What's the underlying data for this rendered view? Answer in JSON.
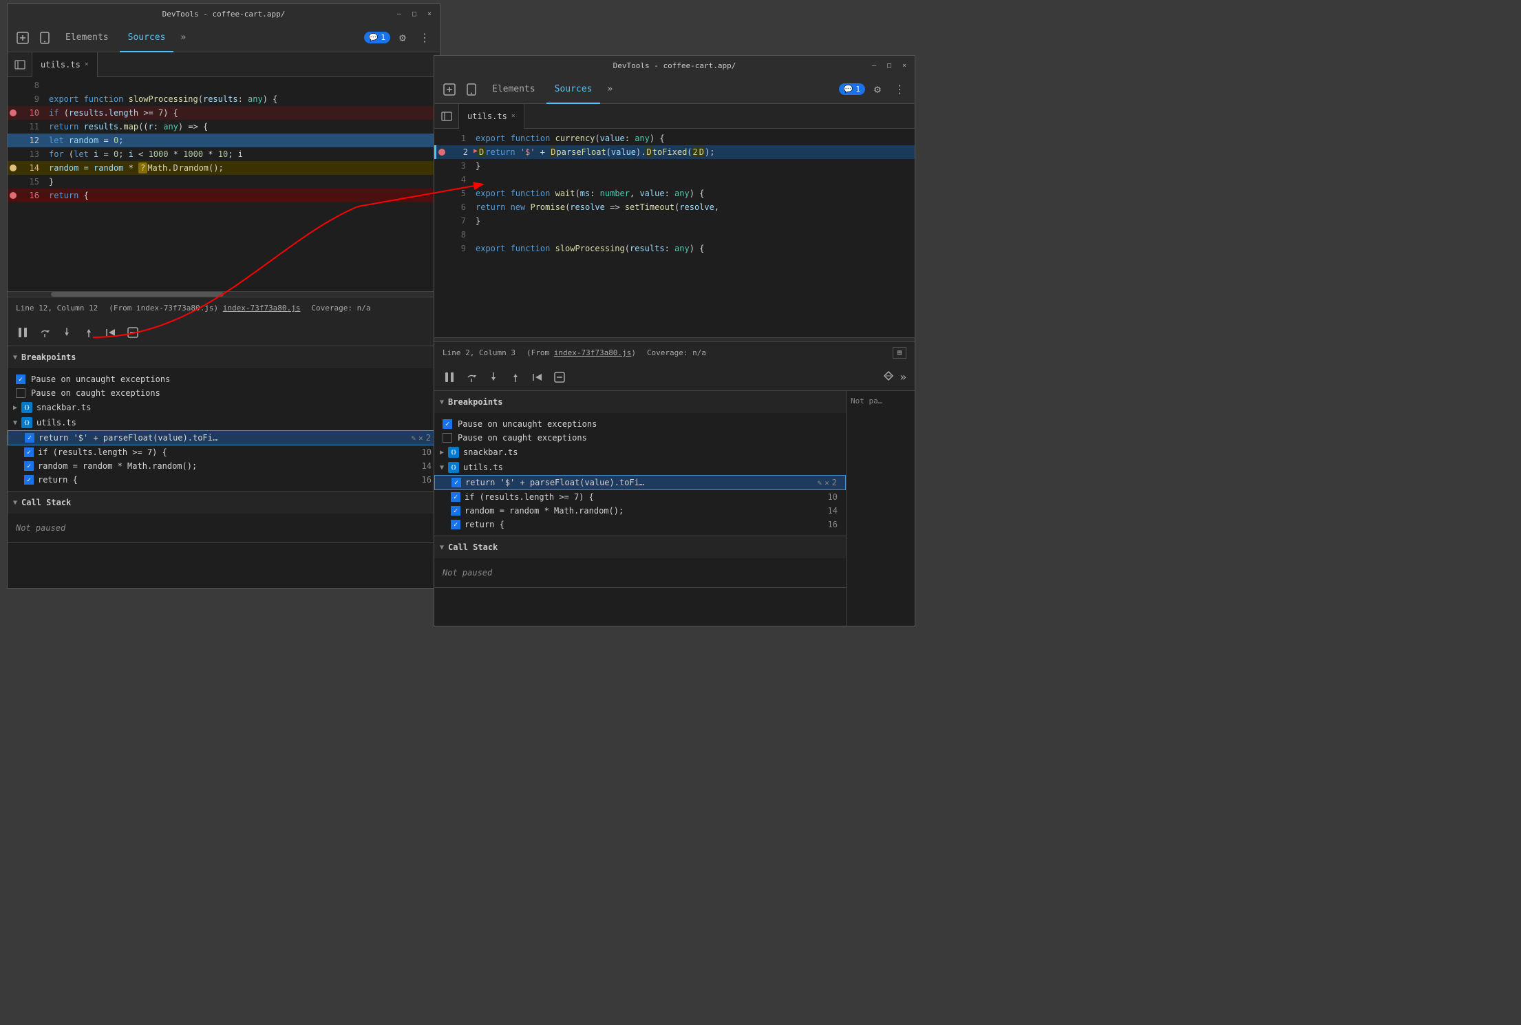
{
  "window1": {
    "title": "DevTools - coffee-cart.app/",
    "tabs": [
      "Elements",
      "Sources"
    ],
    "active_tab": "Sources",
    "file_tab": "utils.ts",
    "code_lines": [
      {
        "num": 8,
        "content": "",
        "type": "normal"
      },
      {
        "num": 9,
        "content": "export function slowProcessing(results: any) {",
        "type": "truncated"
      },
      {
        "num": 10,
        "content": "  if (results.length >= 7) {",
        "type": "breakpoint"
      },
      {
        "num": 11,
        "content": "    return results.map((r: any) => {",
        "type": "normal"
      },
      {
        "num": 12,
        "content": "      let random = 0;",
        "type": "normal"
      },
      {
        "num": 13,
        "content": "      for (let i = 0; i < 1000 * 1000 * 10; i",
        "type": "truncated"
      },
      {
        "num": 14,
        "content": "        random = random * Math.random();",
        "type": "breakpoint_question"
      },
      {
        "num": 15,
        "content": "      }",
        "type": "normal"
      },
      {
        "num": 16,
        "content": "      return {",
        "type": "breakpoint_active"
      }
    ],
    "status_line": "Line 12, Column 12",
    "status_from": "(From index-73f73a80.js)",
    "status_coverage": "Coverage: n/a",
    "debugger_sections": {
      "breakpoints_label": "Breakpoints",
      "pause_uncaught": "Pause on uncaught exceptions",
      "pause_caught": "Pause on caught exceptions",
      "files": [
        {
          "name": "snackbar.ts",
          "expanded": false
        },
        {
          "name": "utils.ts",
          "expanded": true,
          "breakpoints": [
            {
              "code": "return '$' + parseFloat(value).toFi…",
              "line": "2",
              "selected": true
            },
            {
              "code": "if (results.length >= 7) {",
              "line": "10"
            },
            {
              "code": "random = random * Math.random();",
              "line": "14"
            },
            {
              "code": "return {",
              "line": "16"
            }
          ]
        }
      ]
    },
    "call_stack_label": "Call Stack"
  },
  "window2": {
    "title": "DevTools - coffee-cart.app/",
    "tabs": [
      "Elements",
      "Sources"
    ],
    "active_tab": "Sources",
    "file_tab": "utils.ts",
    "code_lines": [
      {
        "num": 1,
        "content": "export function currency(value: any) {",
        "type": "normal"
      },
      {
        "num": 2,
        "content": "  return '$' + parseFloat(value).toFixed(2);",
        "type": "execution"
      },
      {
        "num": 3,
        "content": "}",
        "type": "normal"
      },
      {
        "num": 4,
        "content": "",
        "type": "normal"
      },
      {
        "num": 5,
        "content": "export function wait(ms: number, value: any) {",
        "type": "normal"
      },
      {
        "num": 6,
        "content": "  return new Promise(resolve => setTimeout(resolve,",
        "type": "truncated"
      },
      {
        "num": 7,
        "content": "}",
        "type": "normal"
      },
      {
        "num": 8,
        "content": "",
        "type": "normal"
      },
      {
        "num": 9,
        "content": "export function slowProcessing(results: any) {",
        "type": "normal"
      }
    ],
    "status_line": "Line 2, Column 3",
    "status_from": "(From index-73f73a80.js)",
    "status_coverage": "Coverage: n/a",
    "debugger_sections": {
      "breakpoints_label": "Breakpoints",
      "pause_uncaught": "Pause on uncaught exceptions",
      "pause_caught": "Pause on caught exceptions",
      "files": [
        {
          "name": "snackbar.ts",
          "expanded": false
        },
        {
          "name": "utils.ts",
          "expanded": true,
          "breakpoints": [
            {
              "code": "return '$' + parseFloat(value).toFi…",
              "line": "2",
              "selected": true
            },
            {
              "code": "if (results.length >= 7) {",
              "line": "10"
            },
            {
              "code": "random = random * Math.random();",
              "line": "14"
            },
            {
              "code": "return {",
              "line": "16"
            }
          ]
        }
      ]
    },
    "call_stack_label": "Call Stack",
    "not_paused": "Not pa…",
    "panel_right": "Not pa…"
  },
  "icons": {
    "close": "×",
    "minimize": "—",
    "maximize": "□",
    "chevron_right": "▶",
    "chevron_down": "▼",
    "gear": "⚙",
    "more": "⋮",
    "chat": "💬",
    "pause": "⏸",
    "step_over": "↷",
    "step_into": "↓",
    "step_out": "↑",
    "continue": "→",
    "deactivate": "⊖",
    "edit": "✎",
    "delete": "×",
    "sidebar": "◧",
    "inspect": "⊹",
    "device": "📱"
  }
}
